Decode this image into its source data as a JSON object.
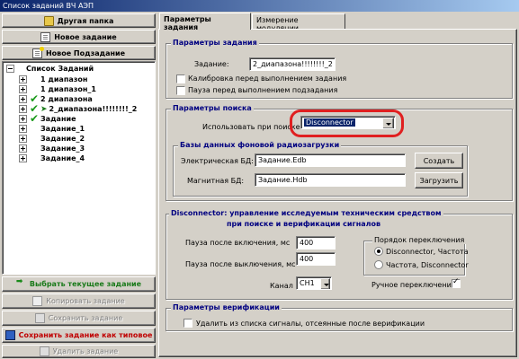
{
  "window": {
    "title": "Список заданий ВЧ АЭП"
  },
  "left_panel": {
    "top_buttons": [
      {
        "label": "Другая папка",
        "icon": "folder-icon"
      },
      {
        "label": "Новое задание",
        "icon": "new-task-icon"
      },
      {
        "label": "Новое Подзадание",
        "icon": "new-subtask-icon"
      }
    ],
    "tree": {
      "root": "Список Заданий",
      "items": [
        {
          "label": "1 диапазон",
          "checked": false,
          "arrow": false
        },
        {
          "label": "1 диапазон_1",
          "checked": false,
          "arrow": false
        },
        {
          "label": "2 диапазона",
          "checked": true,
          "arrow": false
        },
        {
          "label": "2_диапазона!!!!!!!!_2",
          "checked": true,
          "arrow": true
        },
        {
          "label": "Задание",
          "checked": true,
          "arrow": false
        },
        {
          "label": "Задание_1",
          "checked": false,
          "arrow": false
        },
        {
          "label": "Задание_2",
          "checked": false,
          "arrow": false
        },
        {
          "label": "Задание_3",
          "checked": false,
          "arrow": false
        },
        {
          "label": "Задание_4",
          "checked": false,
          "arrow": false
        }
      ]
    },
    "bottom_buttons": [
      {
        "label": "Выбрать текущее задание",
        "color": "#1a7a1a",
        "enabled": true
      },
      {
        "label": "Копировать задание",
        "enabled": false
      },
      {
        "label": "Сохранить задание",
        "enabled": false
      },
      {
        "label": "Сохранить задание как типовое",
        "color": "#c00000",
        "enabled": true
      },
      {
        "label": "Удалить задание",
        "enabled": false
      }
    ]
  },
  "tabs": [
    {
      "label": "Параметры задания",
      "active": true
    },
    {
      "label": "Измерение модуляции",
      "active": false
    }
  ],
  "task_params": {
    "title": "Параметры задания",
    "task_label": "Задание:",
    "task_value": "2_диапазона!!!!!!!!_2",
    "calibrate_label": "Калибровка перед выполнением задания",
    "calibrate_checked": false,
    "pause_label": "Пауза перед выполнением подзадания",
    "pause_checked": false
  },
  "search_params": {
    "title": "Параметры поиска",
    "use_label": "Использовать при поиске:",
    "use_value": "Disconnector",
    "db_group_title": "Базы данных фоновой радиозагрузки",
    "electric_label": "Электрическая БД:",
    "electric_value": "Задание.Edb",
    "create_button": "Создать",
    "magnetic_label": "Магнитная БД:",
    "magnetic_value": "Задание.Hdb",
    "load_button": "Загрузить"
  },
  "disconnector": {
    "title_line1": "Disconnector: управление исследуемым техническим средством",
    "title_line2": "при поиске и верификации сигналов",
    "pause_on_label": "Пауза после включения, мс",
    "pause_on_value": "400",
    "pause_off_label": "Пауза после выключения, мс",
    "pause_off_value": "400",
    "order_title": "Порядок переключения",
    "order_options": [
      {
        "label": "Disconnector, Частота",
        "selected": true
      },
      {
        "label": "Частота, Disconnector",
        "selected": false
      }
    ],
    "channel_label": "Канал",
    "channel_value": "CH1",
    "manual_label": "Ручное переключение",
    "manual_checked": true
  },
  "verification": {
    "title": "Параметры верификации",
    "remove_label": "Удалить из списка сигналы, отсеянные после верификации",
    "remove_checked": false
  },
  "colors": {
    "title_bar": "#0a246a",
    "group_title": "#000080",
    "highlight": "#e02020",
    "check": "#1a9a1a"
  }
}
